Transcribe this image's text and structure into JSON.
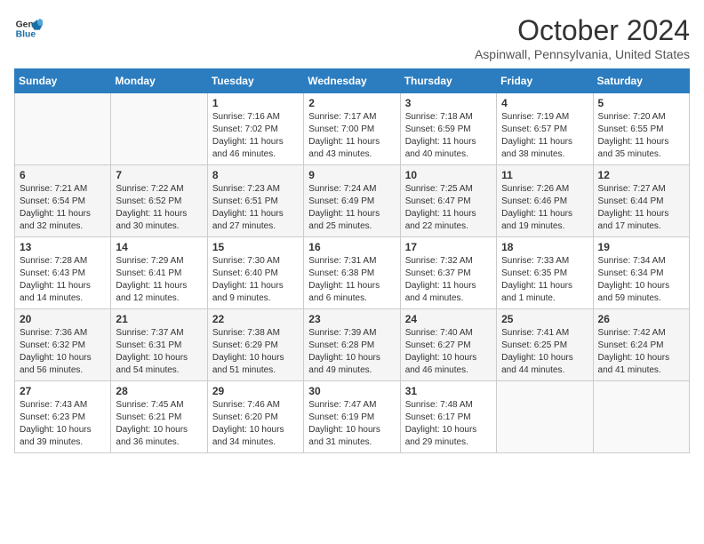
{
  "logo": {
    "line1": "General",
    "line2": "Blue"
  },
  "title": "October 2024",
  "subtitle": "Aspinwall, Pennsylvania, United States",
  "weekdays": [
    "Sunday",
    "Monday",
    "Tuesday",
    "Wednesday",
    "Thursday",
    "Friday",
    "Saturday"
  ],
  "weeks": [
    [
      {
        "day": "",
        "info": ""
      },
      {
        "day": "",
        "info": ""
      },
      {
        "day": "1",
        "info": "Sunrise: 7:16 AM\nSunset: 7:02 PM\nDaylight: 11 hours and 46 minutes."
      },
      {
        "day": "2",
        "info": "Sunrise: 7:17 AM\nSunset: 7:00 PM\nDaylight: 11 hours and 43 minutes."
      },
      {
        "day": "3",
        "info": "Sunrise: 7:18 AM\nSunset: 6:59 PM\nDaylight: 11 hours and 40 minutes."
      },
      {
        "day": "4",
        "info": "Sunrise: 7:19 AM\nSunset: 6:57 PM\nDaylight: 11 hours and 38 minutes."
      },
      {
        "day": "5",
        "info": "Sunrise: 7:20 AM\nSunset: 6:55 PM\nDaylight: 11 hours and 35 minutes."
      }
    ],
    [
      {
        "day": "6",
        "info": "Sunrise: 7:21 AM\nSunset: 6:54 PM\nDaylight: 11 hours and 32 minutes."
      },
      {
        "day": "7",
        "info": "Sunrise: 7:22 AM\nSunset: 6:52 PM\nDaylight: 11 hours and 30 minutes."
      },
      {
        "day": "8",
        "info": "Sunrise: 7:23 AM\nSunset: 6:51 PM\nDaylight: 11 hours and 27 minutes."
      },
      {
        "day": "9",
        "info": "Sunrise: 7:24 AM\nSunset: 6:49 PM\nDaylight: 11 hours and 25 minutes."
      },
      {
        "day": "10",
        "info": "Sunrise: 7:25 AM\nSunset: 6:47 PM\nDaylight: 11 hours and 22 minutes."
      },
      {
        "day": "11",
        "info": "Sunrise: 7:26 AM\nSunset: 6:46 PM\nDaylight: 11 hours and 19 minutes."
      },
      {
        "day": "12",
        "info": "Sunrise: 7:27 AM\nSunset: 6:44 PM\nDaylight: 11 hours and 17 minutes."
      }
    ],
    [
      {
        "day": "13",
        "info": "Sunrise: 7:28 AM\nSunset: 6:43 PM\nDaylight: 11 hours and 14 minutes."
      },
      {
        "day": "14",
        "info": "Sunrise: 7:29 AM\nSunset: 6:41 PM\nDaylight: 11 hours and 12 minutes."
      },
      {
        "day": "15",
        "info": "Sunrise: 7:30 AM\nSunset: 6:40 PM\nDaylight: 11 hours and 9 minutes."
      },
      {
        "day": "16",
        "info": "Sunrise: 7:31 AM\nSunset: 6:38 PM\nDaylight: 11 hours and 6 minutes."
      },
      {
        "day": "17",
        "info": "Sunrise: 7:32 AM\nSunset: 6:37 PM\nDaylight: 11 hours and 4 minutes."
      },
      {
        "day": "18",
        "info": "Sunrise: 7:33 AM\nSunset: 6:35 PM\nDaylight: 11 hours and 1 minute."
      },
      {
        "day": "19",
        "info": "Sunrise: 7:34 AM\nSunset: 6:34 PM\nDaylight: 10 hours and 59 minutes."
      }
    ],
    [
      {
        "day": "20",
        "info": "Sunrise: 7:36 AM\nSunset: 6:32 PM\nDaylight: 10 hours and 56 minutes."
      },
      {
        "day": "21",
        "info": "Sunrise: 7:37 AM\nSunset: 6:31 PM\nDaylight: 10 hours and 54 minutes."
      },
      {
        "day": "22",
        "info": "Sunrise: 7:38 AM\nSunset: 6:29 PM\nDaylight: 10 hours and 51 minutes."
      },
      {
        "day": "23",
        "info": "Sunrise: 7:39 AM\nSunset: 6:28 PM\nDaylight: 10 hours and 49 minutes."
      },
      {
        "day": "24",
        "info": "Sunrise: 7:40 AM\nSunset: 6:27 PM\nDaylight: 10 hours and 46 minutes."
      },
      {
        "day": "25",
        "info": "Sunrise: 7:41 AM\nSunset: 6:25 PM\nDaylight: 10 hours and 44 minutes."
      },
      {
        "day": "26",
        "info": "Sunrise: 7:42 AM\nSunset: 6:24 PM\nDaylight: 10 hours and 41 minutes."
      }
    ],
    [
      {
        "day": "27",
        "info": "Sunrise: 7:43 AM\nSunset: 6:23 PM\nDaylight: 10 hours and 39 minutes."
      },
      {
        "day": "28",
        "info": "Sunrise: 7:45 AM\nSunset: 6:21 PM\nDaylight: 10 hours and 36 minutes."
      },
      {
        "day": "29",
        "info": "Sunrise: 7:46 AM\nSunset: 6:20 PM\nDaylight: 10 hours and 34 minutes."
      },
      {
        "day": "30",
        "info": "Sunrise: 7:47 AM\nSunset: 6:19 PM\nDaylight: 10 hours and 31 minutes."
      },
      {
        "day": "31",
        "info": "Sunrise: 7:48 AM\nSunset: 6:17 PM\nDaylight: 10 hours and 29 minutes."
      },
      {
        "day": "",
        "info": ""
      },
      {
        "day": "",
        "info": ""
      }
    ]
  ]
}
